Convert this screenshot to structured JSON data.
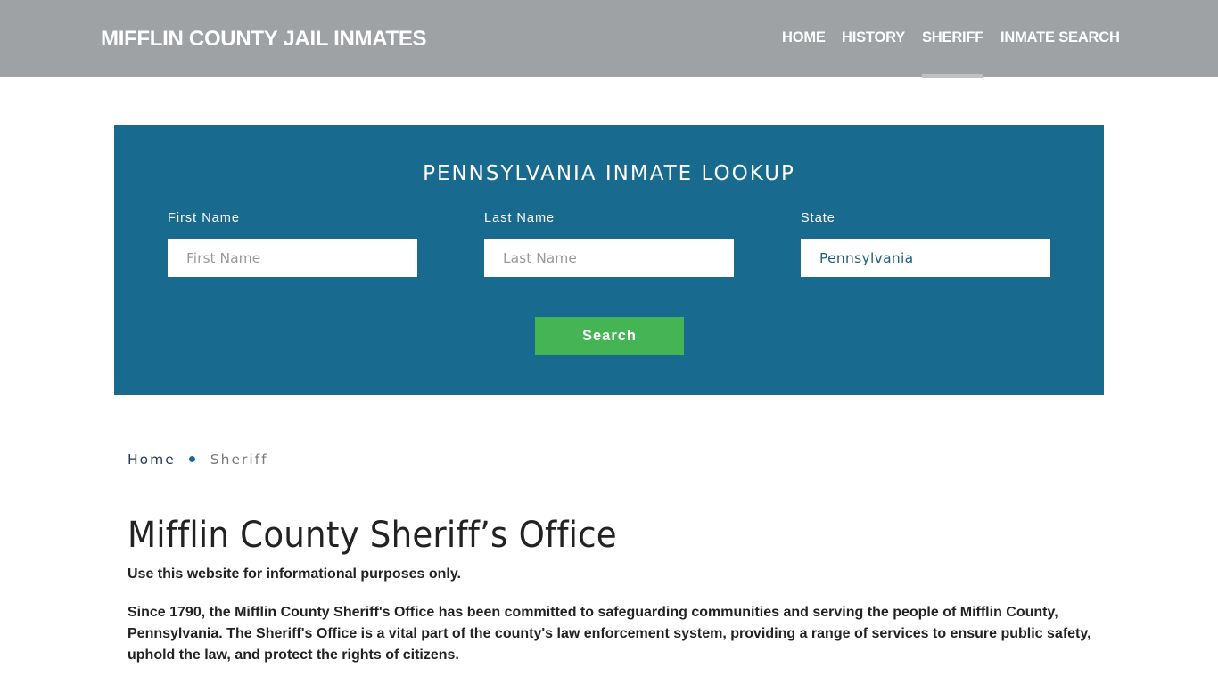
{
  "header": {
    "brand": "MIFFLIN COUNTY JAIL INMATES",
    "nav": [
      {
        "label": "HOME",
        "active": false
      },
      {
        "label": "HISTORY",
        "active": false
      },
      {
        "label": "SHERIFF",
        "active": true
      },
      {
        "label": "INMATE SEARCH",
        "active": false
      }
    ]
  },
  "lookup": {
    "title": "PENNSYLVANIA INMATE LOOKUP",
    "fields": {
      "first_name": {
        "label": "First Name",
        "placeholder": "First Name",
        "value": ""
      },
      "last_name": {
        "label": "Last Name",
        "placeholder": "Last Name",
        "value": ""
      },
      "state": {
        "label": "State",
        "placeholder": "",
        "value": "Pennsylvania"
      }
    },
    "search_label": "Search",
    "colors": {
      "panel": "#186a8e",
      "button": "#44b455"
    }
  },
  "breadcrumb": {
    "home": "Home",
    "current": "Sheriff"
  },
  "content": {
    "title": "Mifflin County Sheriff’s Office",
    "disclaimer": "Use this website for informational purposes only.",
    "intro": "Since 1790, the Mifflin County Sheriff's Office has been committed to safeguarding communities and serving the people of Mifflin County, Pennsylvania. The Sheriff's Office is a vital part of the county's law enforcement system, providing a range of services to ensure public safety, uphold the law, and protect the rights of citizens."
  }
}
